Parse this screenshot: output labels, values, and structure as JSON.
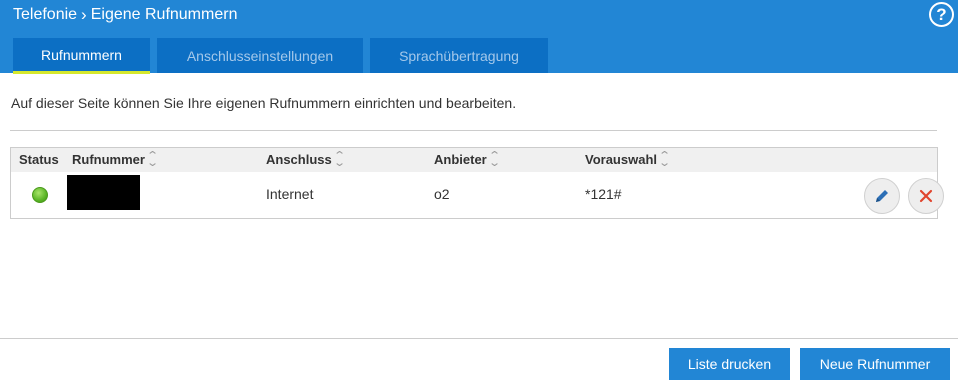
{
  "header": {
    "breadcrumb": [
      "Telefonie",
      "Eigene Rufnummern"
    ],
    "separator": "›",
    "help_label": "?"
  },
  "tabs": [
    {
      "label": "Rufnummern",
      "active": true
    },
    {
      "label": "Anschlusseinstellungen",
      "active": false
    },
    {
      "label": "Sprachübertragung",
      "active": false
    }
  ],
  "intro_text": "Auf dieser Seite können Sie Ihre eigenen Rufnummern einrichten und bearbeiten.",
  "table": {
    "columns": [
      "Status",
      "Rufnummer",
      "Anschluss",
      "Anbieter",
      "Vorauswahl"
    ],
    "rows": [
      {
        "status": "green",
        "rufnummer": "",
        "anschluss": "Internet",
        "anbieter": "o2",
        "vorauswahl": "*121#"
      }
    ]
  },
  "buttons": {
    "print": "Liste drucken",
    "new": "Neue Rufnummer"
  },
  "colors": {
    "header_bg": "#2286d5",
    "tab_bg": "#0c6fc4",
    "tab_active_underline": "#d6e82d",
    "button_bg": "#2286d5",
    "edit_icon": "#2c6fb6",
    "delete_icon": "#e0452e"
  },
  "icons": [
    "help-icon",
    "sort-icon",
    "status-ok-icon",
    "edit-icon",
    "delete-icon"
  ]
}
